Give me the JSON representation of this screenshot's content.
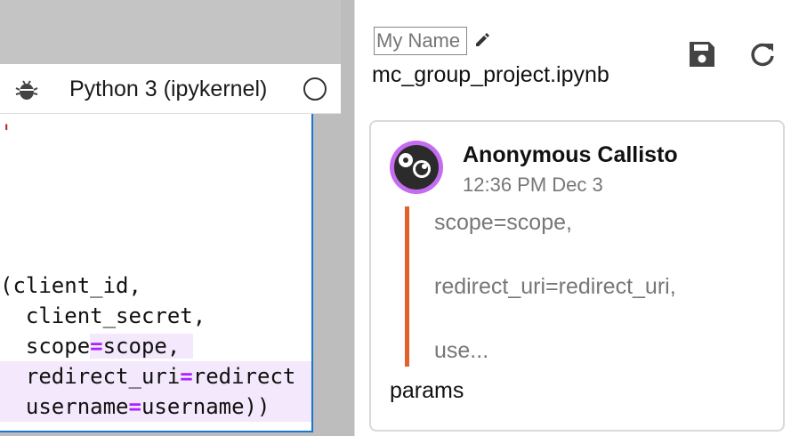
{
  "notebook": {
    "kernel_name": "Python 3 (ipykernel)",
    "code_lines": {
      "l0": "'",
      "l1": "(client_id,",
      "l2": "  client_secret,",
      "l3a": "  scope",
      "l3b": "=",
      "l3c": "scope, ",
      "l4a": "  redirect_uri",
      "l4b": "=",
      "l4c": "redirect",
      "l5a": "  username",
      "l5b": "=",
      "l5c": "username))"
    }
  },
  "chat": {
    "name_input_placeholder": "My Name",
    "notebook_name": "mc_group_project.ipynb",
    "message": {
      "author": "Anonymous Callisto",
      "timestamp": "12:36 PM Dec 3",
      "quote_lines": [
        "scope=scope,",
        "redirect_uri=redirect_uri,",
        "use..."
      ],
      "body": "params"
    }
  },
  "icons": {
    "debug": "bug-icon",
    "kernel_status": "circle-icon",
    "edit": "pencil-icon",
    "save": "save-icon",
    "refresh": "refresh-icon",
    "avatar": "avatar-icon"
  },
  "colors": {
    "accent_border": "#1976d2",
    "avatar_ring": "#c56cf0",
    "quote_bar": "#e0622a",
    "highlight": "#f3e8fc",
    "operator": "#aa22ff"
  }
}
